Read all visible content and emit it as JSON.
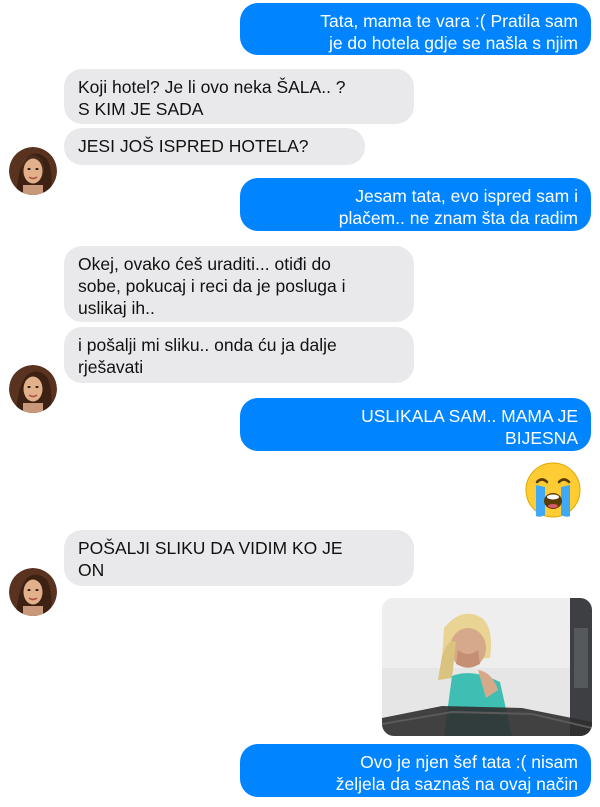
{
  "messages": {
    "m1": "Tata, mama te vara :( Pratila sam\nje do hotela gdje se našla s njim",
    "m2": "Koji hotel? Je li ovo neka ŠALA.. ?\nS KIM JE SADA",
    "m3": "JESI JOŠ ISPRED HOTELA?",
    "m4": "Jesam tata, evo ispred sam i\nplačem.. ne znam šta da radim",
    "m5": "Okej, ovako ćeš uraditi... otiđi do\nsobe, pokucaj i reci da je posluga i\nuslikaj ih..",
    "m6": "i pošalji mi sliku.. onda ću ja dalje\nrješavati",
    "m7": "USLIKALA SAM.. MAMA JE\nBIJESNA",
    "m8": "POŠALJI SLIKU DA VIDIM KO JE\nON",
    "m9": "Ovo je njen šef tata :( nisam\nželjela da saznaš na ovaj način"
  },
  "icons": {
    "emoji": "loudly-crying-face-icon",
    "avatar": "contact-avatar-photo"
  },
  "colors": {
    "sent_bubble": "#0084ff",
    "received_bubble": "#e9e9eb",
    "emoji_face": "#ffcc33",
    "tears": "#3fa9f5"
  }
}
